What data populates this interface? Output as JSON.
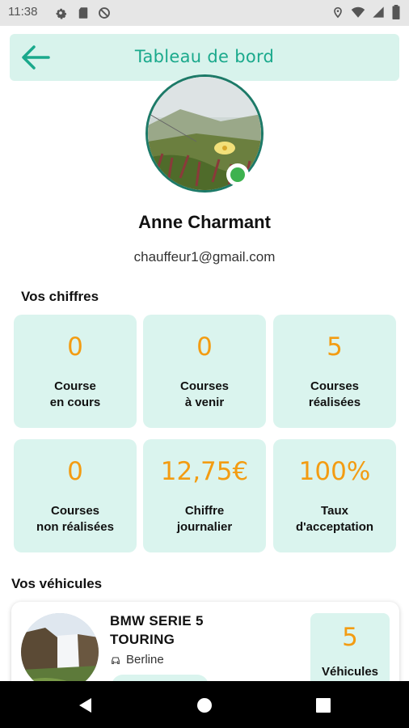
{
  "status_bar": {
    "time": "11:38",
    "icons_left": [
      "gear-icon",
      "sd-card-icon",
      "no-sync-icon"
    ],
    "icons_right": [
      "location-icon",
      "wifi-icon",
      "signal-icon",
      "battery-icon"
    ]
  },
  "header": {
    "title": "Tableau de bord",
    "back_icon": "arrow-left-icon"
  },
  "profile": {
    "name": "Anne Charmant",
    "email": "chauffeur1@gmail.com",
    "online": true
  },
  "stats_section": {
    "title": "Vos chiffres",
    "cards": [
      {
        "value": "0",
        "label": "Course\nen cours"
      },
      {
        "value": "0",
        "label": "Courses\nà venir"
      },
      {
        "value": "5",
        "label": "Courses\nréalisées"
      },
      {
        "value": "0",
        "label": "Courses\nnon réalisées"
      },
      {
        "value": "12,75€",
        "label": "Chiffre\njournalier"
      },
      {
        "value": "100%",
        "label": "Taux\nd'acceptation"
      }
    ]
  },
  "vehicles_section": {
    "title": "Vos véhicules",
    "vehicle": {
      "name": "BMW SERIE 5 TOURING",
      "type": "Berline"
    },
    "count": {
      "value": "5",
      "label": "Véhicules"
    }
  },
  "colors": {
    "accent": "#1aa98c",
    "card_bg": "#daf4ee",
    "value_orange": "#f39c12",
    "online_green": "#3db24f"
  }
}
